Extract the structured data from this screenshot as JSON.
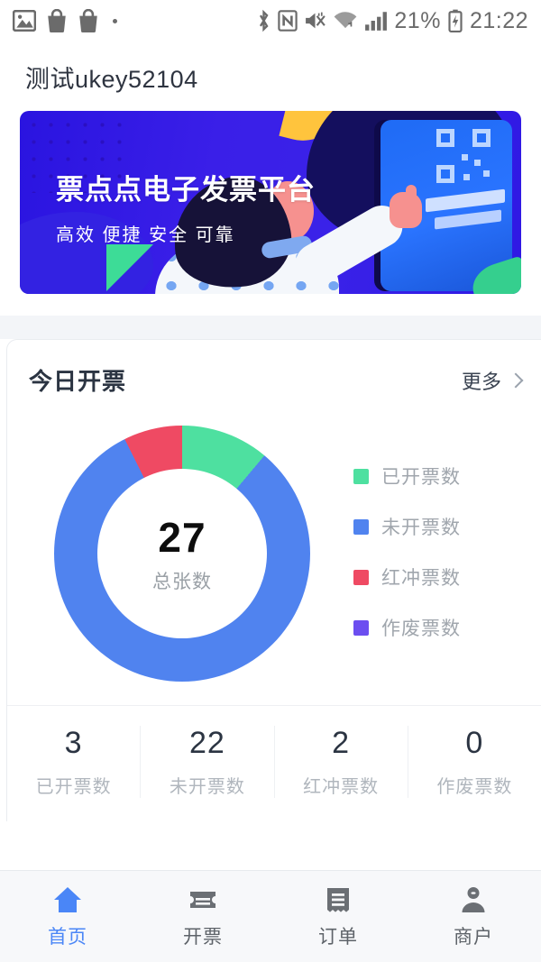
{
  "statusbar": {
    "left_icons": [
      "gallery-icon",
      "shopping-bag-icon",
      "shopping-bag-icon",
      "dot-indicator"
    ],
    "right_icons": [
      "bluetooth-icon",
      "nfc-icon",
      "mute-icon",
      "wifi-icon",
      "signal-icon",
      "battery-charging-icon"
    ],
    "battery_percent": "21%",
    "clock": "21:22"
  },
  "header": {
    "title": "测试ukey52104"
  },
  "banner": {
    "title": "票点点电子发票平台",
    "subtitle": "高效  便捷  安全  可靠",
    "bg_start": "#2a14e0",
    "bg_end": "#2f18e4",
    "accent_yellow": "#ffc43d",
    "accent_green": "#3ddc97",
    "screen_blue": "#2a74ff"
  },
  "card": {
    "title": "今日开票",
    "more_label": "更多"
  },
  "chart_data": {
    "type": "pie",
    "title": "今日开票",
    "center_value": "27",
    "center_label": "总张数",
    "total": 27,
    "categories": [
      "已开票数",
      "未开票数",
      "红冲票数",
      "作废票数"
    ],
    "values": [
      3,
      22,
      2,
      0
    ],
    "colors": [
      "#4ee0a0",
      "#5083ef",
      "#ef4a63",
      "#6c4ef0"
    ],
    "legend_position": "right",
    "donut": true,
    "start_angle_deg": 0,
    "direction": "clockwise",
    "slices": [
      {
        "label": "已开票数",
        "value": 3,
        "color": "#4ee0a0",
        "start_deg": 0,
        "end_deg": 40
      },
      {
        "label": "未开票数",
        "value": 22,
        "color": "#5083ef",
        "start_deg": 40,
        "end_deg": 333.3
      },
      {
        "label": "红冲票数",
        "value": 2,
        "color": "#ef4a63",
        "start_deg": 333.3,
        "end_deg": 360
      },
      {
        "label": "作废票数",
        "value": 0,
        "color": "#6c4ef0",
        "start_deg": 360,
        "end_deg": 360
      }
    ]
  },
  "legend": [
    {
      "label": "已开票数",
      "color": "#4ee0a0"
    },
    {
      "label": "未开票数",
      "color": "#5083ef"
    },
    {
      "label": "红冲票数",
      "color": "#ef4a63"
    },
    {
      "label": "作废票数",
      "color": "#6c4ef0"
    }
  ],
  "stats": [
    {
      "value": "3",
      "label": "已开票数"
    },
    {
      "value": "22",
      "label": "未开票数"
    },
    {
      "value": "2",
      "label": "红冲票数"
    },
    {
      "value": "0",
      "label": "作废票数"
    }
  ],
  "tabbar": {
    "active_color": "#4a86f7",
    "inactive_color": "#5e6369",
    "items": [
      {
        "label": "首页",
        "icon": "home-icon",
        "active": true
      },
      {
        "label": "开票",
        "icon": "ticket-icon",
        "active": false
      },
      {
        "label": "订单",
        "icon": "receipt-icon",
        "active": false
      },
      {
        "label": "商户",
        "icon": "person-icon",
        "active": false
      }
    ]
  }
}
